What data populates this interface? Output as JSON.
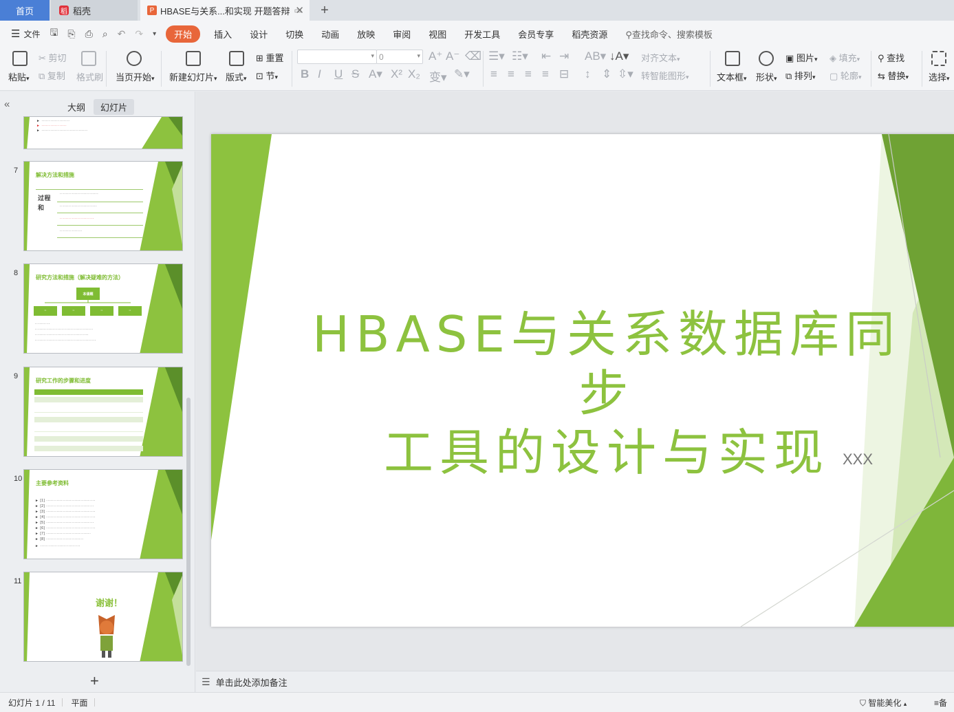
{
  "tabs": {
    "home": "首页",
    "daoke": "稻壳",
    "doc": "HBASE与关系...和实现 开题答辩"
  },
  "menu": {
    "file": "文件",
    "items": [
      "开始",
      "插入",
      "设计",
      "切换",
      "动画",
      "放映",
      "审阅",
      "视图",
      "开发工具",
      "会员专享",
      "稻壳资源"
    ],
    "search": "查找命令、搜索模板"
  },
  "ribbon": {
    "paste": "粘贴",
    "cut": "剪切",
    "copy": "复制",
    "format_painter": "格式刷",
    "play_from_current": "当页开始",
    "new_slide": "新建幻灯片",
    "layout": "版式",
    "reset": "重置",
    "section": "节",
    "font_size": "0",
    "align_text": "对齐文本",
    "smart_art": "转智能图形",
    "textbox": "文本框",
    "shape": "形状",
    "picture": "图片",
    "arrange": "排列",
    "fill": "填充",
    "outline": "轮廓",
    "find": "查找",
    "replace": "替换",
    "select": "选择"
  },
  "left_panel": {
    "outline_tab": "大纲",
    "slides_tab": "幻灯片",
    "slides": [
      {
        "num": "7",
        "title": "解决方法和措施"
      },
      {
        "num": "8",
        "title": "研究方法和措施（解决疑难的方法）"
      },
      {
        "num": "9",
        "title": "研究工作的步骤和进度"
      },
      {
        "num": "10",
        "title": "主要参考资料"
      },
      {
        "num": "11",
        "title": "谢谢！"
      }
    ]
  },
  "slide": {
    "title_line1": "HBASE与关系数据库同步",
    "title_line2": "工具的设计与实现",
    "subtitle": "XXX"
  },
  "notes_placeholder": "单击此处添加备注",
  "status": {
    "slide_counter": "幻灯片 1 / 11",
    "theme": "平面",
    "beautify": "智能美化",
    "notes_btn": "备"
  },
  "colors": {
    "accent_orange": "#e8663a",
    "slide_green": "#8dc23f",
    "home_tab_blue": "#4a7fd6"
  }
}
